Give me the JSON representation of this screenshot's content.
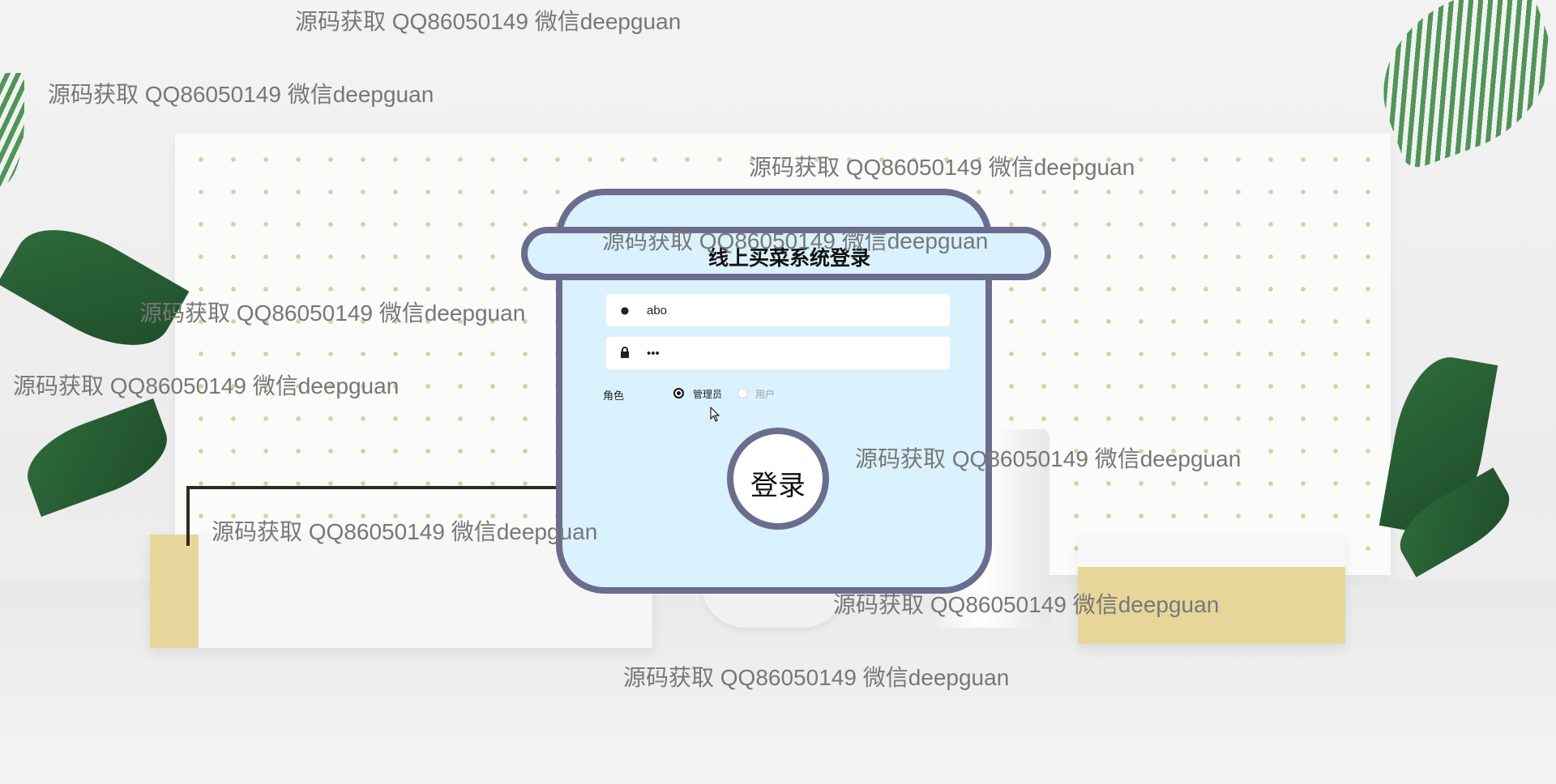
{
  "watermark_text": "源码获取 QQ86050149 微信deepguan",
  "login": {
    "title": "线上买菜系统登录",
    "username_value": "abo",
    "password_masked": "•••",
    "role_label": "角色",
    "role_options": [
      "管理员",
      "用户"
    ],
    "selected_role": "管理员",
    "submit_label": "登录"
  },
  "icons": {
    "username": "user-icon",
    "password": "lock-icon"
  },
  "colors": {
    "card_bg": "#daf2fd",
    "card_border": "#6b6d8f",
    "text": "#111111",
    "disabled_text": "#a0a0a0"
  }
}
